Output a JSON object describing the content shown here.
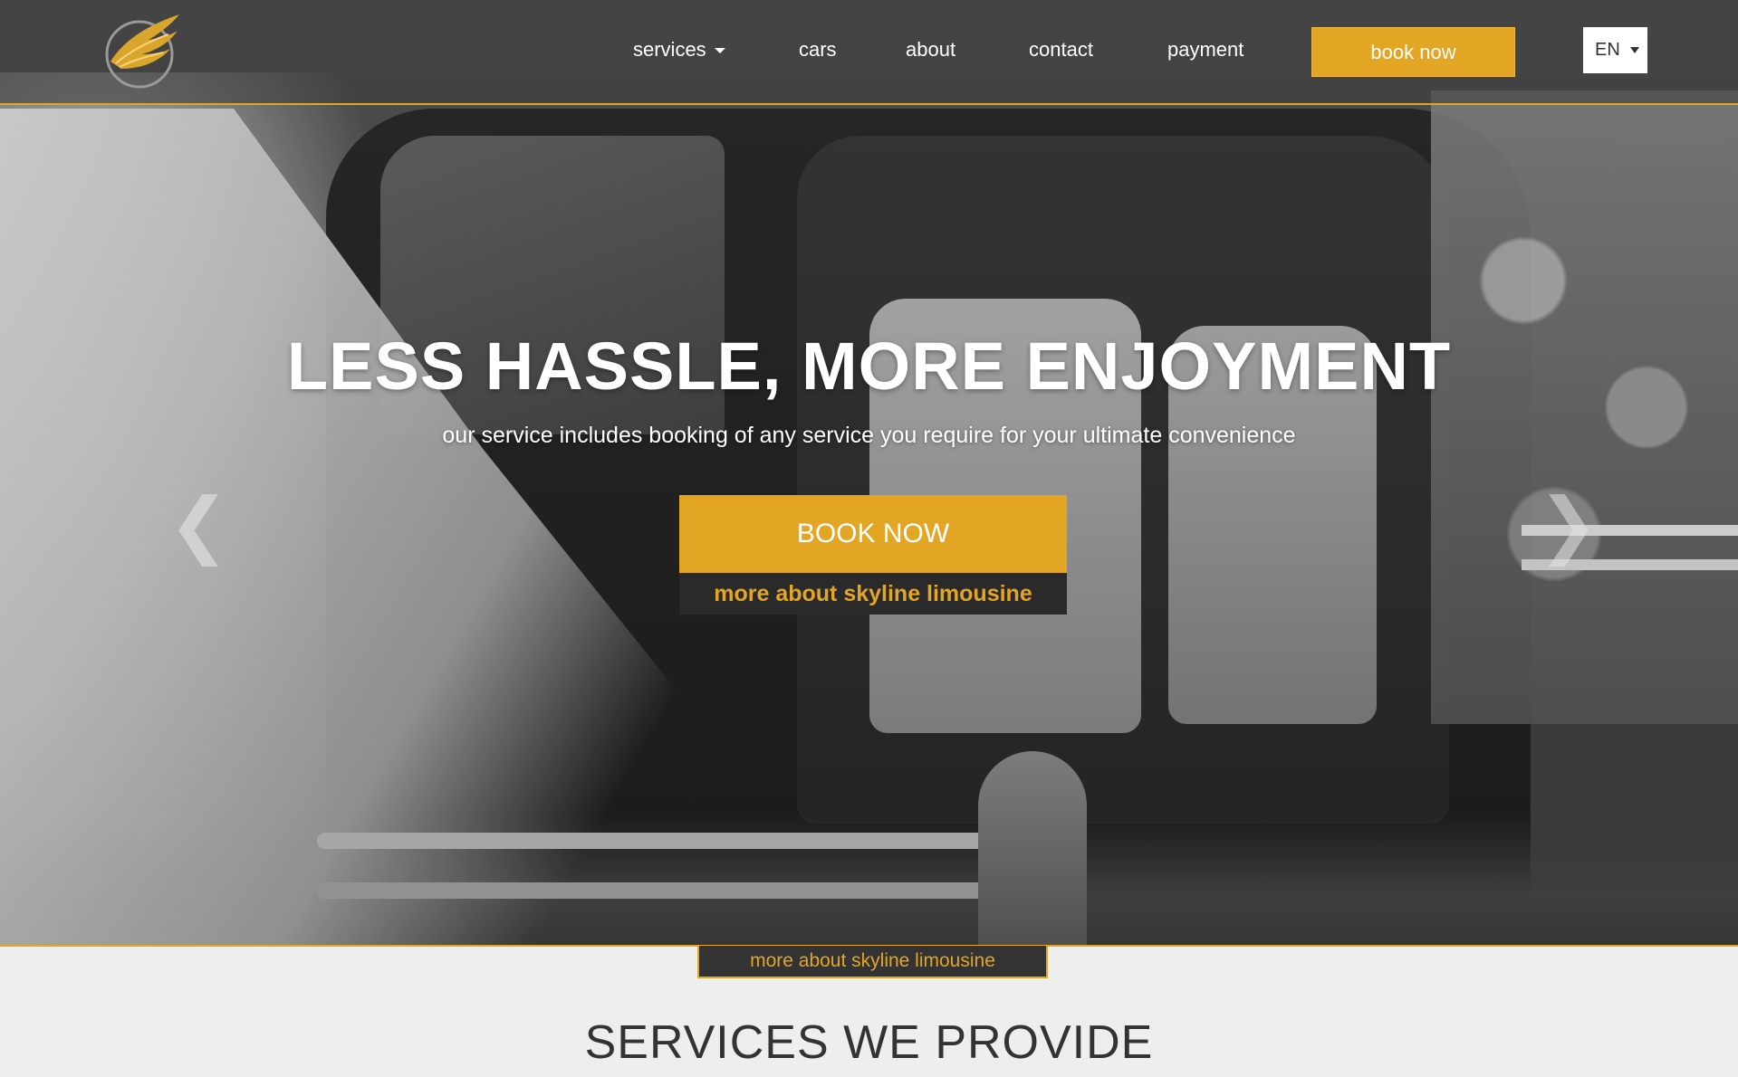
{
  "brand": {
    "accent_color": "#e3a524",
    "logo_icon": "golden-wing-icon"
  },
  "nav": {
    "items": [
      {
        "label": "services",
        "has_dropdown": true
      },
      {
        "label": "cars"
      },
      {
        "label": "about"
      },
      {
        "label": "contact"
      },
      {
        "label": "payment"
      }
    ],
    "book_label": "book now",
    "language": "EN"
  },
  "hero": {
    "title": "LESS HASSLE, MORE ENJOYMENT",
    "subtitle": "our service includes booking of any service you require for your ultimate convenience",
    "book_button": "BOOK NOW",
    "more_link": "more about skyline limousine",
    "prev_arrow": "❮",
    "next_arrow": "❯"
  },
  "bottom": {
    "more_tab": "more about skyline limousine",
    "section_title": "SERVICES WE PROVIDE"
  }
}
